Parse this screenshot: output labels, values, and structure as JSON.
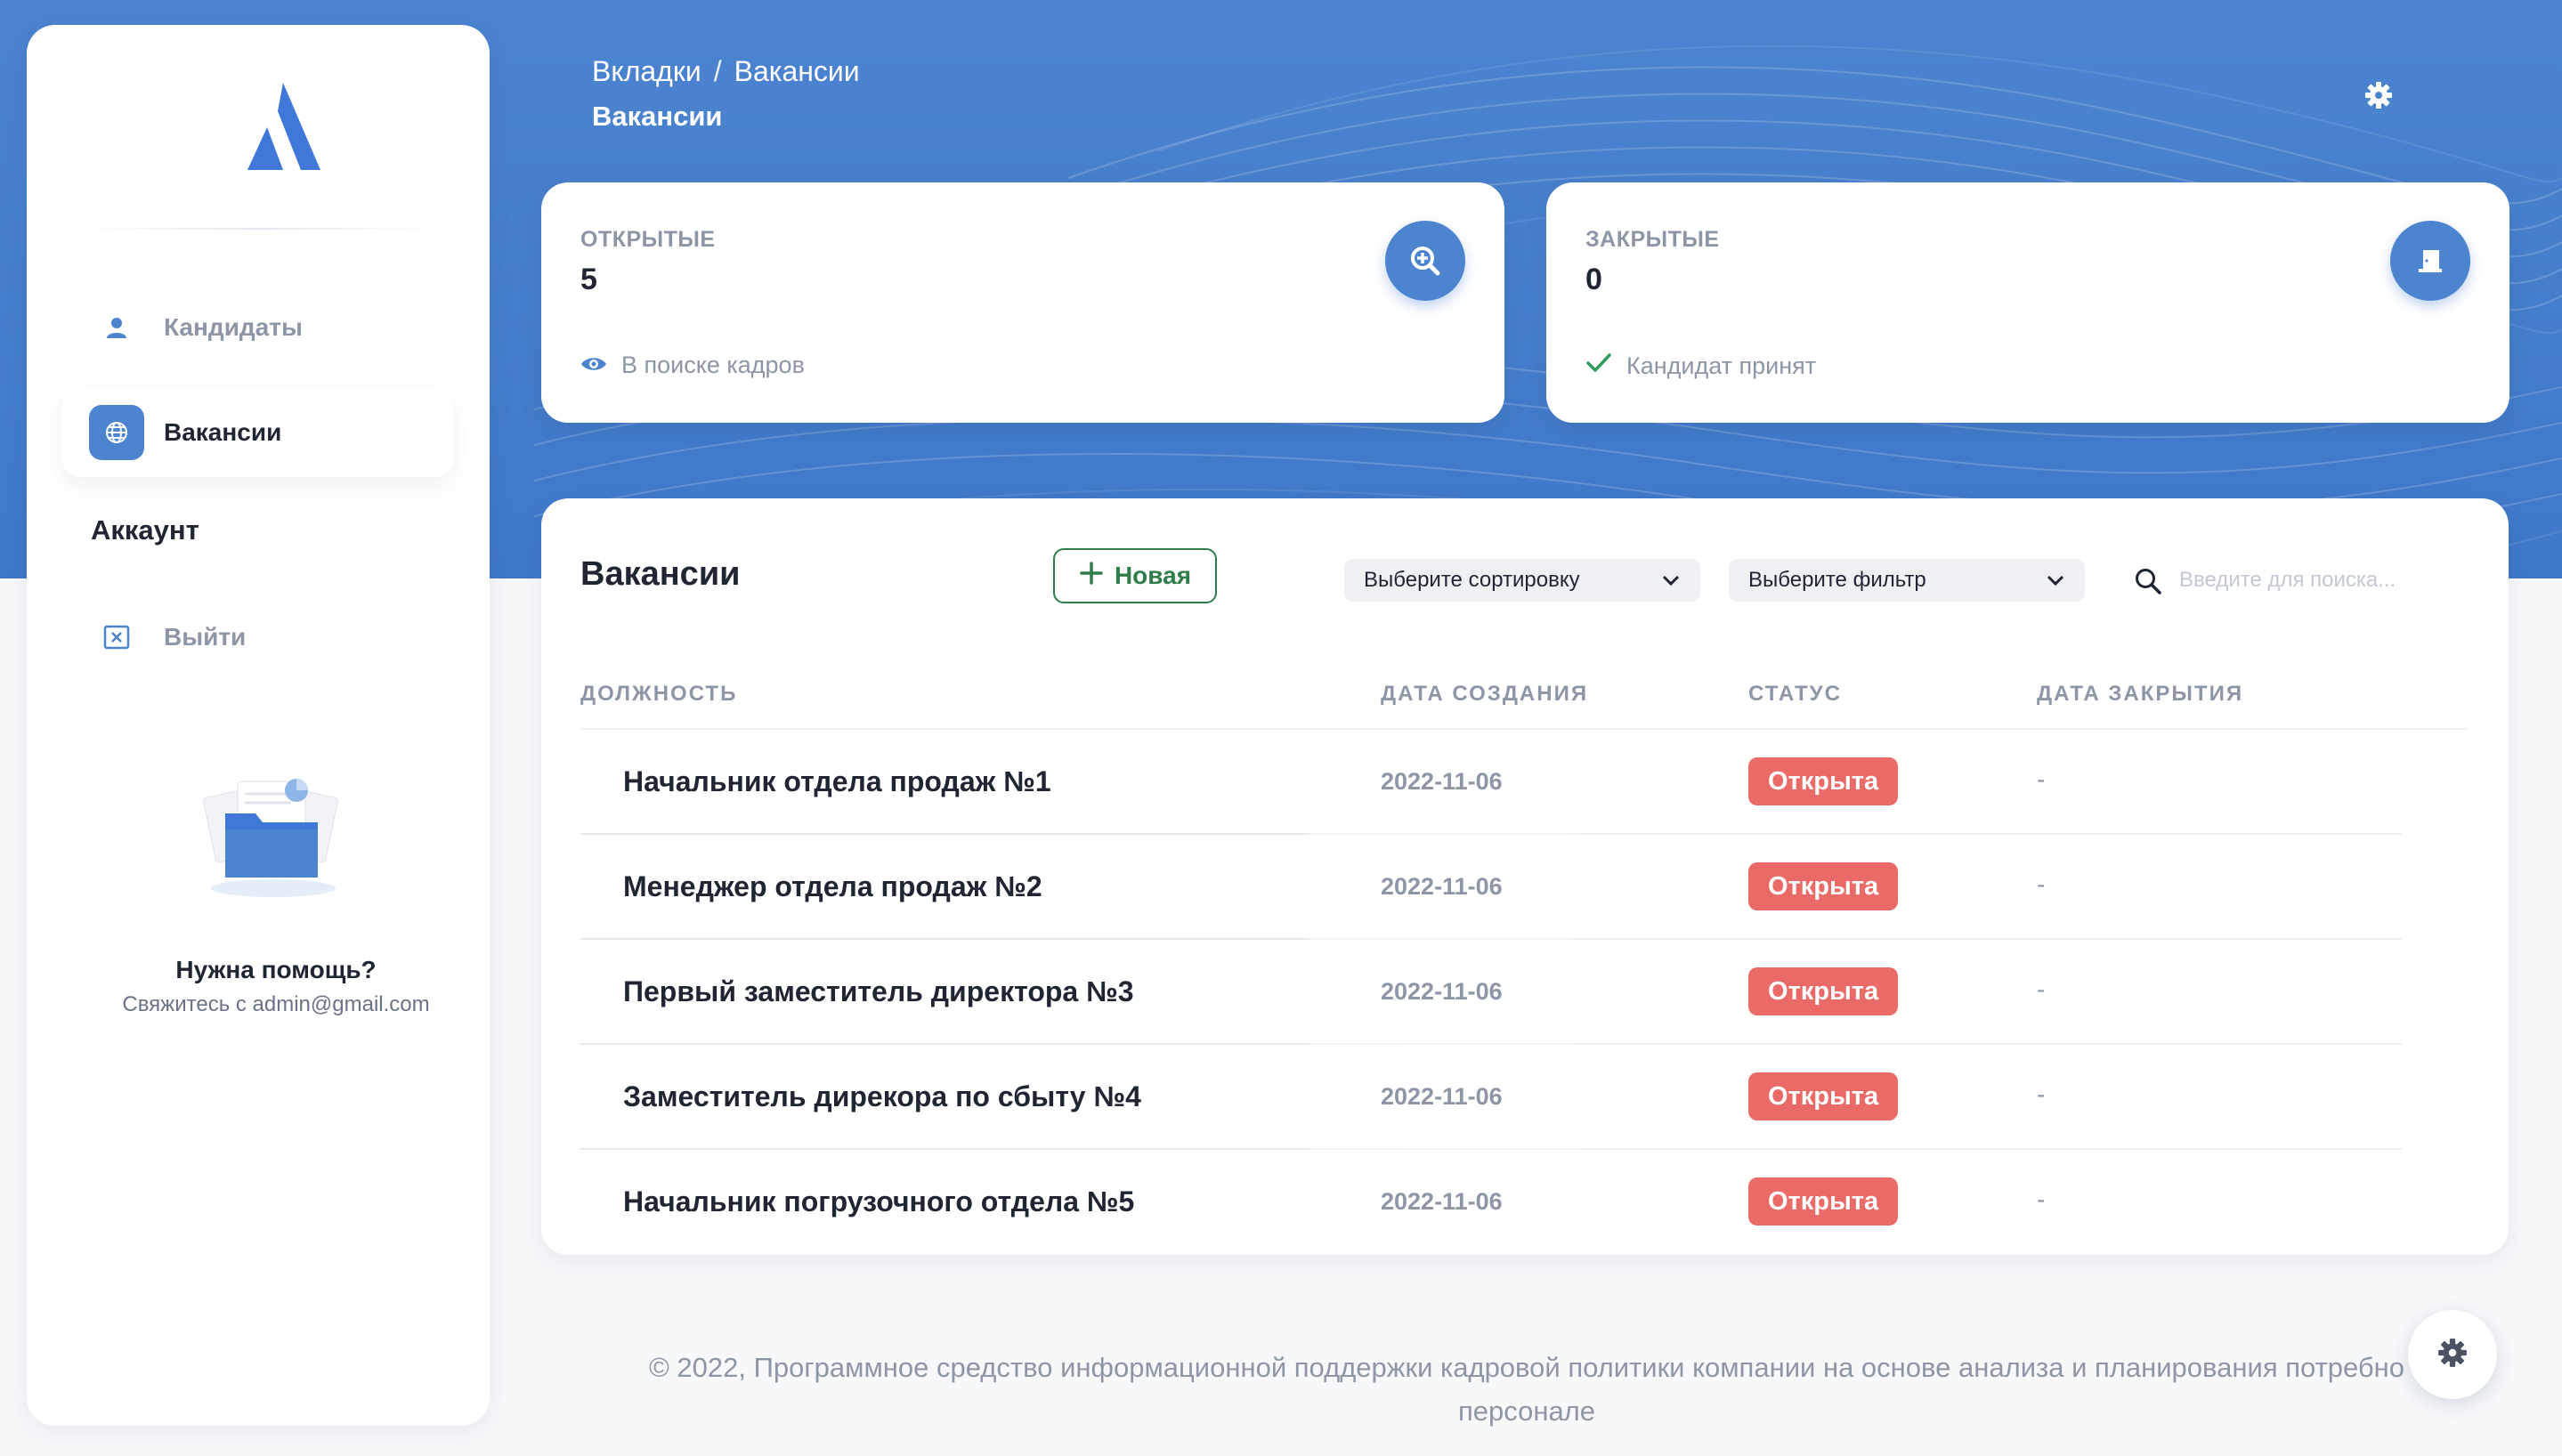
{
  "header": {
    "breadcrumb": [
      "Вкладки",
      "Вакансии"
    ],
    "breadcrumb_sep": "/",
    "title": "Вакансии",
    "settings_icon": "gear-icon"
  },
  "sidebar": {
    "logo_icon": "logo-icon",
    "items": [
      {
        "label": "Кандидаты",
        "icon": "user-icon",
        "active": false
      },
      {
        "label": "Вакансии",
        "icon": "globe-icon",
        "active": true
      }
    ],
    "account_title": "Аккаунт",
    "account_items": [
      {
        "label": "Выйти",
        "icon": "close-box-icon"
      }
    ],
    "help": {
      "illustration": "folder-illustration",
      "title": "Нужна помощь?",
      "subtitle": "Свяжитесь с admin@gmail.com"
    }
  },
  "stats": [
    {
      "label": "ОТКРЫТЫЕ",
      "value": "5",
      "icon": "zoom-icon",
      "foot_icon": "eye-icon",
      "foot": "В поиске кадров"
    },
    {
      "label": "ЗАКРЫТЫЕ",
      "value": "0",
      "icon": "door-icon",
      "foot_icon": "check-icon",
      "foot": "Кандидат принят"
    }
  ],
  "vacancies": {
    "title": "Вакансии",
    "new_button": "Новая",
    "sort_select": {
      "value": "Выберите сортировку"
    },
    "filter_select": {
      "value": "Выберите фильтр"
    },
    "search": {
      "placeholder": "Введите для поиска..."
    },
    "columns": [
      "ДОЛЖНОСТЬ",
      "ДАТА СОЗДАНИЯ",
      "СТАТУС",
      "ДАТА ЗАКРЫТИЯ"
    ],
    "rows": [
      {
        "position": "Начальник отдела продаж №1",
        "created": "2022-11-06",
        "status": "Открыта",
        "closed": "-"
      },
      {
        "position": "Менеджер отдела продаж №2",
        "created": "2022-11-06",
        "status": "Открыта",
        "closed": "-"
      },
      {
        "position": "Первый заместитель директора №3",
        "created": "2022-11-06",
        "status": "Открыта",
        "closed": "-"
      },
      {
        "position": "Заместитель дирекора по сбыту №4",
        "created": "2022-11-06",
        "status": "Открыта",
        "closed": "-"
      },
      {
        "position": "Начальник погрузочного отдела №5",
        "created": "2022-11-06",
        "status": "Открыта",
        "closed": "-"
      }
    ]
  },
  "footer": {
    "line1": "© 2022, Программное средство информационной поддержки кадровой политики компании на основе анализа и планирования потребно",
    "line2": "персонале"
  },
  "colors": {
    "primary": "#4c84d0",
    "badge_open": "#e96a67",
    "new_button": "#2f7d4a",
    "muted": "#8d96a6"
  }
}
